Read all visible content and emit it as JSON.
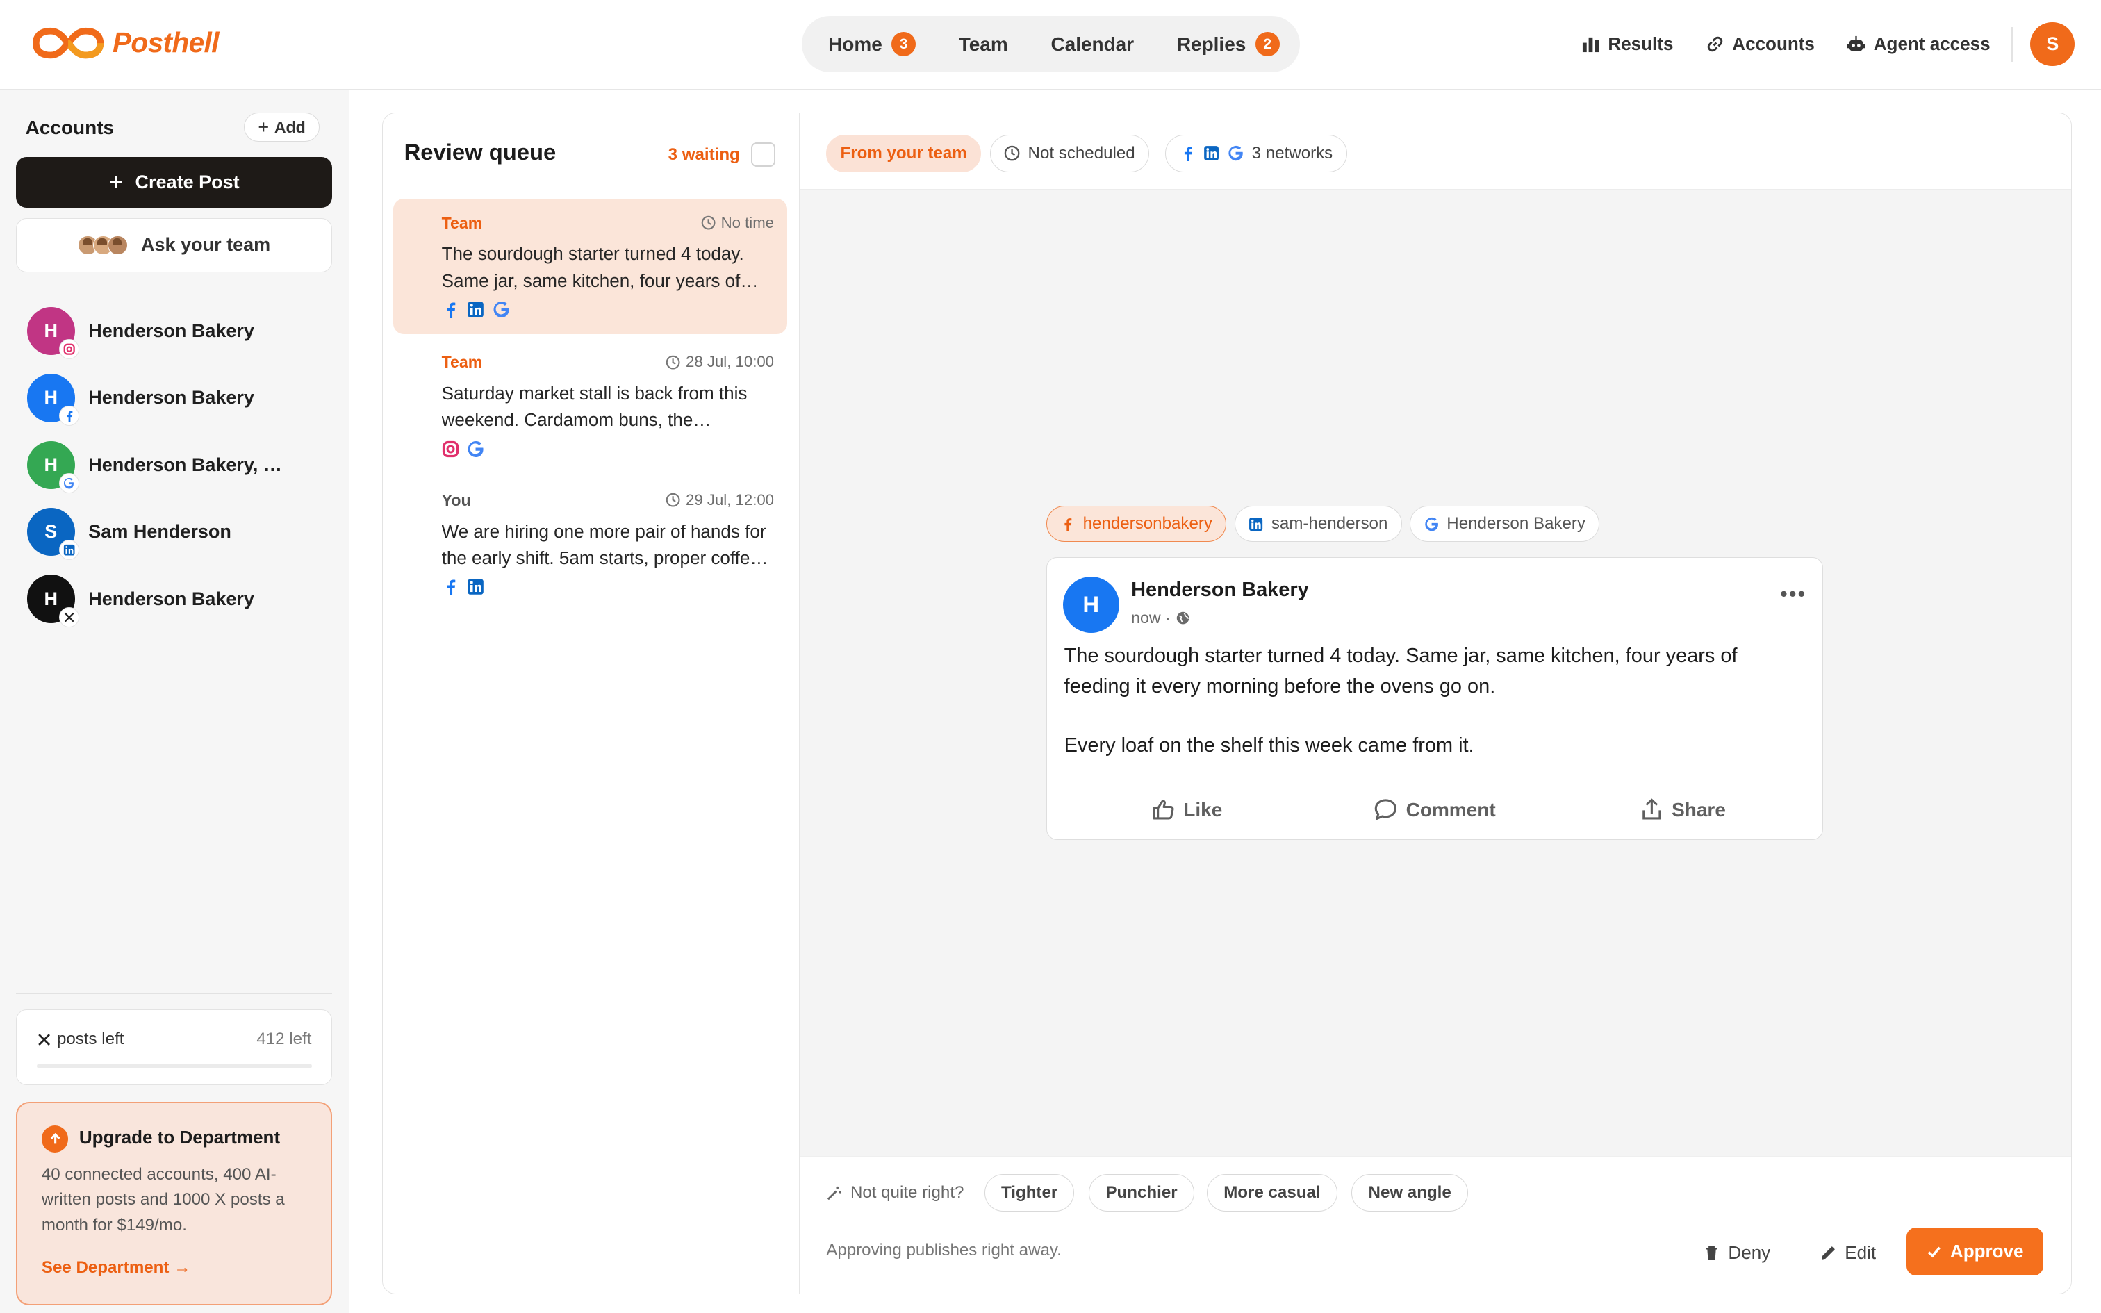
{
  "app": {
    "logo_text": "Posthell",
    "brand_color": "#f06a1a"
  },
  "nav": {
    "items": [
      {
        "label": "Home",
        "badge": "3"
      },
      {
        "label": "Team"
      },
      {
        "label": "Calendar"
      },
      {
        "label": "Replies",
        "badge": "2"
      }
    ]
  },
  "topbar": {
    "results_label": "Results",
    "accounts_label": "Accounts",
    "agent_label": "Agent access",
    "user_initial": "S"
  },
  "sidebar": {
    "title": "Accounts",
    "add_label": "Add",
    "create_label": "Create Post",
    "ask_label": "Ask your team",
    "accounts": [
      {
        "initial": "H",
        "name": "Henderson Bakery",
        "network": "instagram",
        "color": "#c13584"
      },
      {
        "initial": "H",
        "name": "Henderson Bakery",
        "network": "facebook",
        "color": "#1877f2"
      },
      {
        "initial": "H",
        "name": "Henderson Bakery, Bristol",
        "network": "google",
        "color": "#34a853"
      },
      {
        "initial": "S",
        "name": "Sam Henderson",
        "network": "linkedin",
        "color": "#0a66c2"
      },
      {
        "initial": "H",
        "name": "Henderson Bakery",
        "network": "x",
        "color": "#111111"
      }
    ],
    "x_posts_label": "posts left",
    "x_posts_count": "412 left",
    "x_posts_used_fraction": 0,
    "upgrade": {
      "title": "Upgrade to Department",
      "body": "40 connected accounts, 400 AI-written posts and 1000 X posts a month for $149/mo.",
      "link": "See Department →"
    }
  },
  "queue": {
    "title": "Review queue",
    "waiting": "3 waiting",
    "items": [
      {
        "role": "Team",
        "time": "No time",
        "text": "The sourdough starter turned 4 today. Same jar, same kitchen, four years of feeding it every morning before the ovens go on.",
        "networks": [
          "facebook",
          "linkedin",
          "google"
        ]
      },
      {
        "role": "Team",
        "time": "28 Jul, 10:00",
        "text": "Saturday market stall is back from this weekend. Cardamom buns, the sourdough and a new rye.",
        "networks": [
          "instagram",
          "google"
        ]
      },
      {
        "role": "You",
        "time": "29 Jul, 12:00",
        "text": "We are hiring one more pair of hands for the early shift. 5am starts, proper coffee and first pick of the bakes.",
        "networks": [
          "facebook",
          "linkedin"
        ]
      }
    ]
  },
  "preview": {
    "chip_source": "From your team",
    "chip_schedule": "Not scheduled",
    "chip_networks": "3 networks",
    "account_tabs": [
      {
        "label": "hendersonbakery",
        "network": "facebook"
      },
      {
        "label": "sam-henderson",
        "network": "linkedin"
      },
      {
        "label": "Henderson Bakery",
        "network": "google"
      }
    ],
    "post": {
      "avatar_initial": "H",
      "page_name": "Henderson Bakery",
      "meta": "now ·",
      "paragraph_1": "The sourdough starter turned 4 today. Same jar, same kitchen, four years of feeding it every morning before the ovens go on.",
      "paragraph_2": "Every loaf on the shelf this week came from it.",
      "like": "Like",
      "comment": "Comment",
      "share": "Share"
    },
    "footer": {
      "prompt": "Not quite right?",
      "tweaks": [
        "Tighter",
        "Punchier",
        "More casual",
        "New angle"
      ],
      "note": "Approving publishes right away.",
      "deny": "Deny",
      "edit": "Edit",
      "approve": "Approve"
    }
  }
}
